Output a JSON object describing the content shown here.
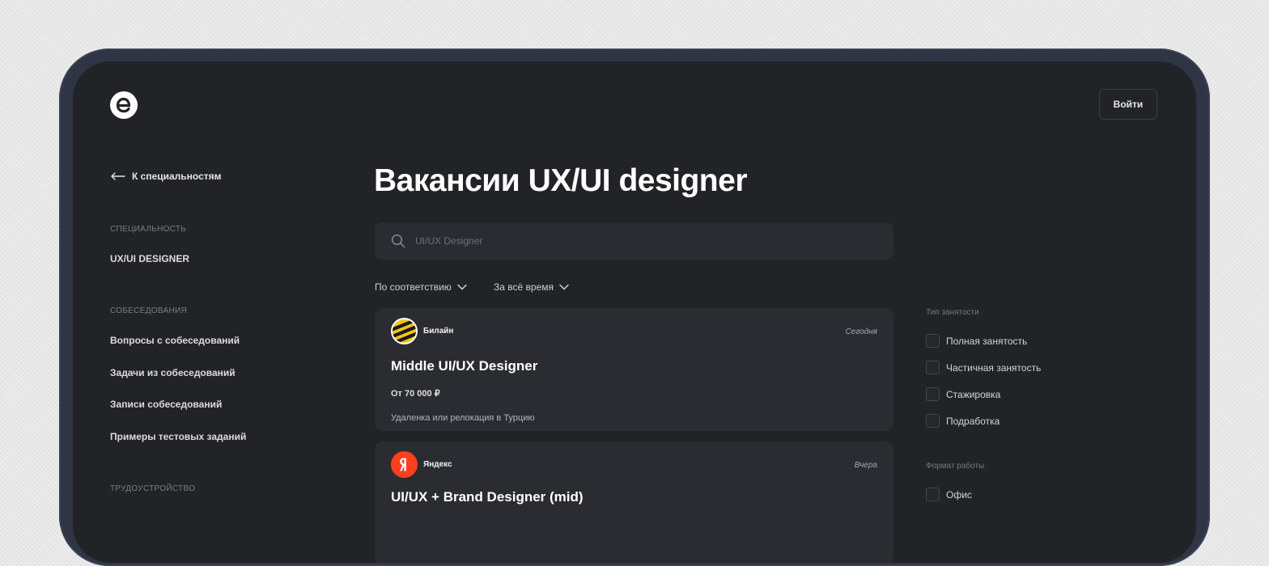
{
  "header": {
    "login_label": "Войти"
  },
  "sidebar": {
    "back_label": "К специальностям",
    "sections": [
      {
        "title": "СПЕЦИАЛЬНОСТЬ",
        "items": [
          "UX/UI DESIGNER"
        ]
      },
      {
        "title": "СОБЕСЕДОВАНИЯ",
        "items": [
          "Вопросы с собеседований",
          "Задачи из собеседований",
          "Записи собеседований",
          "Примеры тестовых заданий"
        ]
      },
      {
        "title": "ТРУДОУСТРОЙСТВО",
        "items": []
      }
    ]
  },
  "main": {
    "title": "Вакансии UX/UI designer",
    "search": {
      "placeholder": "UI/UX Designer",
      "value": ""
    },
    "sort": {
      "relevance_label": "По соответствию",
      "period_label": "За всё время"
    },
    "vacancies": [
      {
        "company": "Билайн",
        "logo_icon": "beeline-logo-icon",
        "date": "Сегодня",
        "title": "Middle UI/UX Designer",
        "salary": "От 70 000 ₽",
        "location": "Удаленка или релокация в Турцию"
      },
      {
        "company": "Яндекс",
        "logo_icon": "yandex-logo-icon",
        "date": "Вчера",
        "title": "UI/UX + Brand Designer (mid)"
      }
    ]
  },
  "filters": {
    "employment": {
      "title": "Тип занятости",
      "options": [
        "Полная занятость",
        "Частичная занятость",
        "Стажировка",
        "Подработка"
      ]
    },
    "format": {
      "title": "Формат работы",
      "options": [
        "Офис"
      ]
    }
  },
  "colors": {
    "background": "#222327",
    "card": "#2b2c31",
    "frame": "#2f3545",
    "beeline_yellow": "#f5c518",
    "yandex_red": "#fc3f1d"
  }
}
